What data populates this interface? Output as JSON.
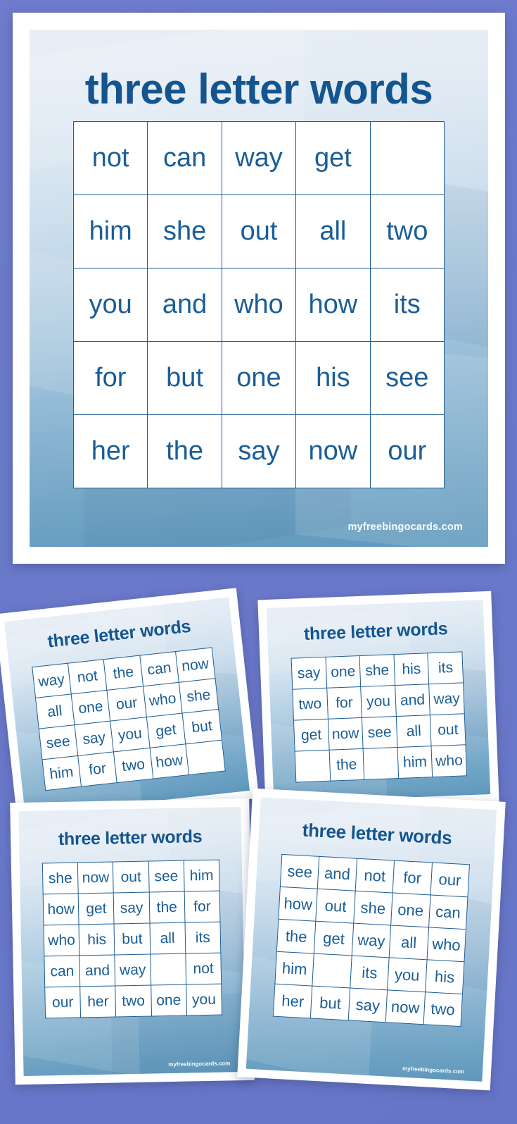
{
  "theme": {
    "background_color": "#6b79cb",
    "card_paper_color": "#ffffff",
    "card_gradient_top": "#e9eff6",
    "card_gradient_bottom": "#5f98bc",
    "text_color": "#15578f",
    "grid_line_color": "#1d5c94"
  },
  "watermark": "myfreebingocards.com",
  "cards": [
    {
      "id": "main-card",
      "title": "three letter words",
      "rows": [
        [
          "not",
          "can",
          "way",
          "get",
          ""
        ],
        [
          "him",
          "she",
          "out",
          "all",
          "two"
        ],
        [
          "you",
          "and",
          "who",
          "how",
          "its"
        ],
        [
          "for",
          "but",
          "one",
          "his",
          "see"
        ],
        [
          "her",
          "the",
          "say",
          "now",
          "our"
        ]
      ]
    },
    {
      "id": "thumb-card-1",
      "title": "three letter words",
      "rows": [
        [
          "way",
          "not",
          "the",
          "can",
          "now"
        ],
        [
          "all",
          "one",
          "our",
          "who",
          "she"
        ],
        [
          "see",
          "say",
          "you",
          "get",
          "but"
        ],
        [
          "him",
          "for",
          "two",
          "how",
          ""
        ]
      ]
    },
    {
      "id": "thumb-card-2",
      "title": "three letter words",
      "rows": [
        [
          "say",
          "one",
          "she",
          "his",
          "its"
        ],
        [
          "two",
          "for",
          "you",
          "and",
          "way"
        ],
        [
          "get",
          "now",
          "see",
          "all",
          "out"
        ],
        [
          "",
          "the",
          "",
          "him",
          "who"
        ]
      ]
    },
    {
      "id": "thumb-card-3",
      "title": "three letter words",
      "rows": [
        [
          "she",
          "now",
          "out",
          "see",
          "him"
        ],
        [
          "how",
          "get",
          "say",
          "the",
          "for"
        ],
        [
          "who",
          "his",
          "but",
          "all",
          "its"
        ],
        [
          "can",
          "and",
          "way",
          "",
          "not"
        ],
        [
          "our",
          "her",
          "two",
          "one",
          "you"
        ]
      ]
    },
    {
      "id": "thumb-card-4",
      "title": "three letter words",
      "rows": [
        [
          "see",
          "and",
          "not",
          "for",
          "our"
        ],
        [
          "how",
          "out",
          "she",
          "one",
          "can"
        ],
        [
          "the",
          "get",
          "way",
          "all",
          "who"
        ],
        [
          "him",
          "",
          "its",
          "you",
          "his"
        ],
        [
          "her",
          "but",
          "say",
          "now",
          "two"
        ]
      ]
    }
  ]
}
